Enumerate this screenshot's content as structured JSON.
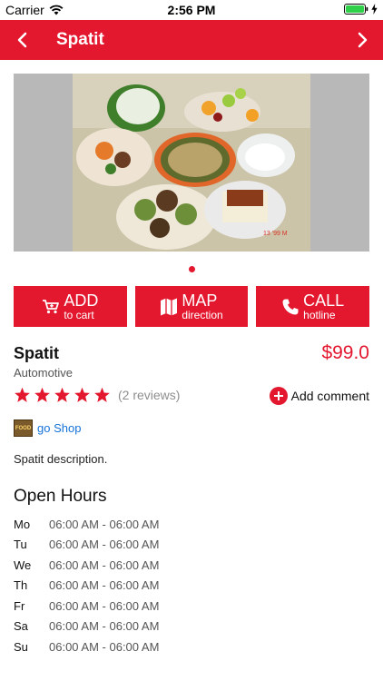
{
  "status_bar": {
    "carrier": "Carrier",
    "time": "2:56 PM"
  },
  "navbar": {
    "title": "Spatit"
  },
  "actions": [
    {
      "main": "ADD",
      "sub": "to cart",
      "icon": "cart-icon"
    },
    {
      "main": "MAP",
      "sub": "direction",
      "icon": "map-icon"
    },
    {
      "main": "CALL",
      "sub": "hotline",
      "icon": "phone-icon"
    }
  ],
  "product": {
    "name": "Spatit",
    "price": "$99.0",
    "category": "Automotive",
    "rating": 5,
    "reviews": "(2 reviews)",
    "add_comment": "Add comment",
    "shop_logo_text": "FOOD",
    "shop_link": "go Shop",
    "description": "Spatit description."
  },
  "open_hours": {
    "title": "Open Hours",
    "rows": [
      {
        "day": "Mo",
        "time": "06:00 AM - 06:00 AM"
      },
      {
        "day": "Tu",
        "time": "06:00 AM - 06:00 AM"
      },
      {
        "day": "We",
        "time": "06:00 AM - 06:00 AM"
      },
      {
        "day": "Th",
        "time": "06:00 AM - 06:00 AM"
      },
      {
        "day": "Fr",
        "time": "06:00 AM - 06:00 AM"
      },
      {
        "day": "Sa",
        "time": "06:00 AM - 06:00 AM"
      },
      {
        "day": "Su",
        "time": "06:00 AM - 06:00 AM"
      }
    ]
  },
  "colors": {
    "accent": "#e3172e",
    "link": "#1673d8",
    "muted": "#8e8e8e"
  }
}
